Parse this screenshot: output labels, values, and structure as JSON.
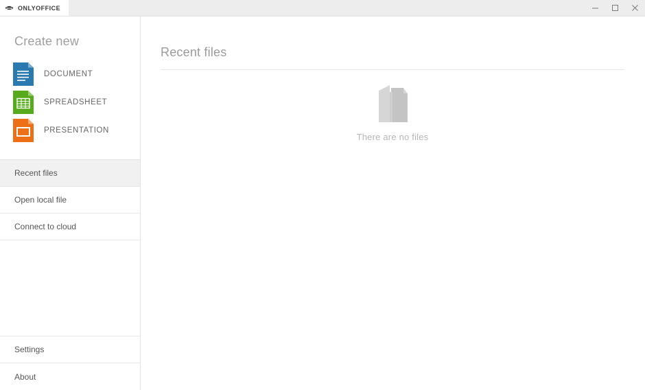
{
  "window": {
    "app_tab_label": "ONLYOFFICE",
    "logo_icon": "onlyoffice-logo-icon",
    "controls": {
      "minimize": "minimize-icon",
      "maximize": "maximize-icon",
      "close": "close-icon"
    }
  },
  "sidebar": {
    "create_new_title": "Create new",
    "create_items": [
      {
        "label": "DOCUMENT",
        "icon": "document-file-icon",
        "color": "#2a7ab0"
      },
      {
        "label": "SPREADSHEET",
        "icon": "spreadsheet-file-icon",
        "color": "#56aa1c"
      },
      {
        "label": "PRESENTATION",
        "icon": "presentation-file-icon",
        "color": "#ed7017"
      }
    ],
    "nav_items": [
      {
        "label": "Recent files",
        "active": true
      },
      {
        "label": "Open local file",
        "active": false
      },
      {
        "label": "Connect to cloud",
        "active": false
      }
    ],
    "bottom_items": [
      {
        "label": "Settings"
      },
      {
        "label": "About"
      }
    ]
  },
  "main": {
    "title": "Recent files",
    "empty_state": {
      "icon": "empty-folder-icon",
      "message": "There are no files"
    }
  },
  "colors": {
    "titlebar_bg": "#ededed",
    "active_nav_bg": "#f1f1f1",
    "heading_text": "#9a9a9a",
    "body_text": "#555555"
  }
}
